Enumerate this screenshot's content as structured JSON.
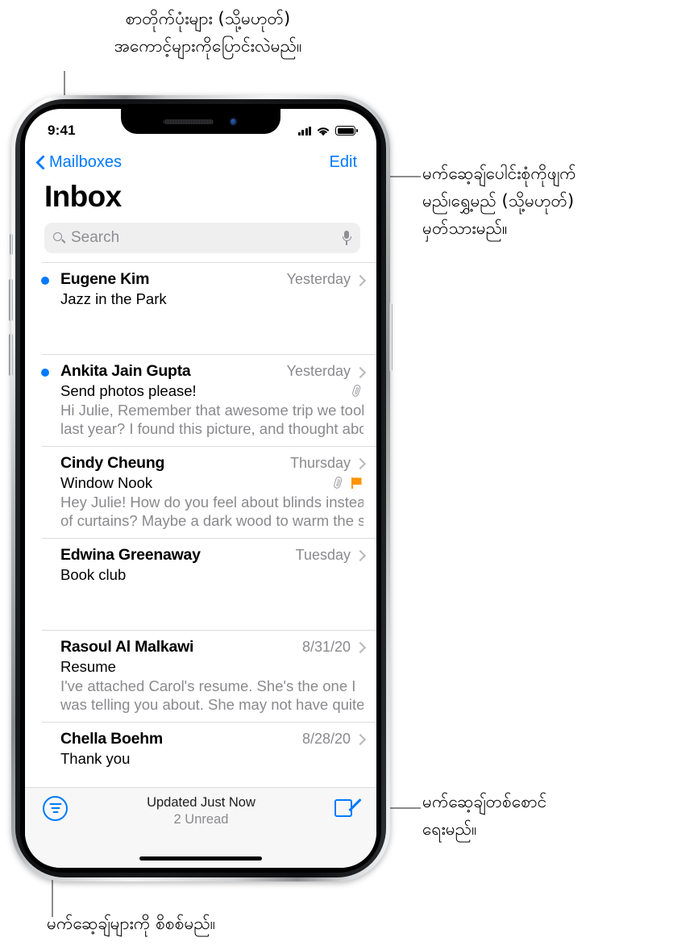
{
  "callouts": {
    "top": "စာတိုက်ပုံးများ (သို့မဟုတ်)\nအကောင့်များကိုပြောင်းလဲမည်။",
    "edit": "မက်ဆေ့ချ်ပေါင်းစုံကိုဖျက်\nမည်၊ရွှေ့မည် (သို့မဟုတ်)\nမှတ်သားမည်။",
    "compose": "မက်ဆေ့ချ်တစ်စောင်\nရေးမည်။",
    "bottom": "မက်ဆေ့ချ်များကို စိစစ်မည်။"
  },
  "status_bar": {
    "time": "9:41",
    "signal_icon": "signal-bars-icon",
    "wifi_icon": "wifi-icon",
    "battery_icon": "battery-full-icon"
  },
  "nav_bar": {
    "back_label": "Mailboxes",
    "back_icon": "chevron-left-icon",
    "edit_label": "Edit"
  },
  "page_title": "Inbox",
  "search": {
    "placeholder": "Search",
    "search_icon": "search-icon",
    "mic_icon": "microphone-icon"
  },
  "mail_list": [
    {
      "sender": "Eugene Kim",
      "date": "Yesterday",
      "subject": "Jazz in the Park",
      "preview": [],
      "unread": true,
      "attachment": false,
      "flagged": false
    },
    {
      "sender": "Ankita Jain Gupta",
      "date": "Yesterday",
      "subject": "Send photos please!",
      "preview": [
        "Hi Julie, Remember that awesome trip we took",
        "last year? I found this picture, and thought abo…"
      ],
      "unread": true,
      "attachment": true,
      "flagged": false
    },
    {
      "sender": "Cindy Cheung",
      "date": "Thursday",
      "subject": "Window Nook",
      "preview": [
        "Hey Julie! How do you feel about blinds instead",
        "of curtains? Maybe a dark wood to warm the s…"
      ],
      "unread": false,
      "attachment": true,
      "flagged": true
    },
    {
      "sender": "Edwina Greenaway",
      "date": "Tuesday",
      "subject": "Book club",
      "preview": [],
      "unread": false,
      "attachment": false,
      "flagged": false
    },
    {
      "sender": "Rasoul Al Malkawi",
      "date": "8/31/20",
      "subject": "Resume",
      "preview": [
        "I've attached Carol's resume. She's the one I",
        "was telling you about. She may not have quite…"
      ],
      "unread": false,
      "attachment": false,
      "flagged": false
    },
    {
      "sender": "Chella Boehm",
      "date": "8/28/20",
      "subject": "Thank you",
      "preview": [],
      "unread": false,
      "attachment": false,
      "flagged": false
    }
  ],
  "toolbar": {
    "filter_icon": "filter-icon",
    "updated_text": "Updated Just Now",
    "unread_text": "2 Unread",
    "compose_icon": "compose-icon"
  },
  "colors": {
    "accent_blue": "#007aff",
    "flag_orange": "#ff9500",
    "secondary_text": "#8a8a8e"
  }
}
